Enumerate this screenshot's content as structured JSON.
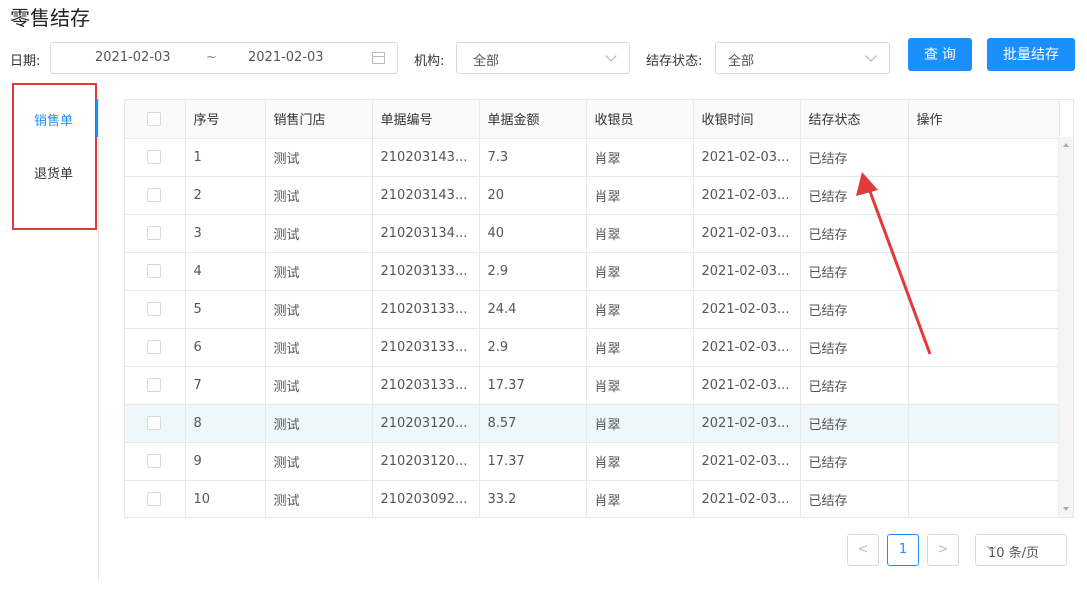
{
  "page": {
    "title": "零售结存"
  },
  "filters": {
    "date_label": "日期:",
    "date_start": "2021-02-03",
    "date_sep": "~",
    "date_end": "2021-02-03",
    "org_label": "机构:",
    "org_value": "全部",
    "status_label": "结存状态:",
    "status_value": "全部",
    "query_button": "查 询",
    "batch_button": "批量结存"
  },
  "sidebar": {
    "items": [
      {
        "label": "销售单",
        "active": true
      },
      {
        "label": "退货单",
        "active": false
      }
    ]
  },
  "table": {
    "headers": [
      "",
      "序号",
      "销售门店",
      "单据编号",
      "单据金额",
      "收银员",
      "收银时间",
      "结存状态",
      "操作"
    ],
    "rows": [
      {
        "no": "1",
        "store": "测试",
        "code": "210203143...",
        "amount": "7.3",
        "cashier": "肖翠",
        "time": "2021-02-03...",
        "status": "已结存"
      },
      {
        "no": "2",
        "store": "测试",
        "code": "210203143...",
        "amount": "20",
        "cashier": "肖翠",
        "time": "2021-02-03...",
        "status": "已结存"
      },
      {
        "no": "3",
        "store": "测试",
        "code": "210203134...",
        "amount": "40",
        "cashier": "肖翠",
        "time": "2021-02-03...",
        "status": "已结存"
      },
      {
        "no": "4",
        "store": "测试",
        "code": "210203133...",
        "amount": "2.9",
        "cashier": "肖翠",
        "time": "2021-02-03...",
        "status": "已结存"
      },
      {
        "no": "5",
        "store": "测试",
        "code": "210203133...",
        "amount": "24.4",
        "cashier": "肖翠",
        "time": "2021-02-03...",
        "status": "已结存"
      },
      {
        "no": "6",
        "store": "测试",
        "code": "210203133...",
        "amount": "2.9",
        "cashier": "肖翠",
        "time": "2021-02-03...",
        "status": "已结存"
      },
      {
        "no": "7",
        "store": "测试",
        "code": "210203133...",
        "amount": "17.37",
        "cashier": "肖翠",
        "time": "2021-02-03...",
        "status": "已结存"
      },
      {
        "no": "8",
        "store": "测试",
        "code": "210203120...",
        "amount": "8.57",
        "cashier": "肖翠",
        "time": "2021-02-03...",
        "status": "已结存"
      },
      {
        "no": "9",
        "store": "测试",
        "code": "210203120...",
        "amount": "17.37",
        "cashier": "肖翠",
        "time": "2021-02-03...",
        "status": "已结存"
      },
      {
        "no": "10",
        "store": "测试",
        "code": "210203092...",
        "amount": "33.2",
        "cashier": "肖翠",
        "time": "2021-02-03...",
        "status": "已结存"
      }
    ]
  },
  "pagination": {
    "prev": "<",
    "current_page": "1",
    "next": ">",
    "page_size": "10 条/页"
  },
  "colors": {
    "accent": "#1a90ff",
    "annotation_red": "#e23a3a",
    "highlight_row": "#eef8fb"
  }
}
